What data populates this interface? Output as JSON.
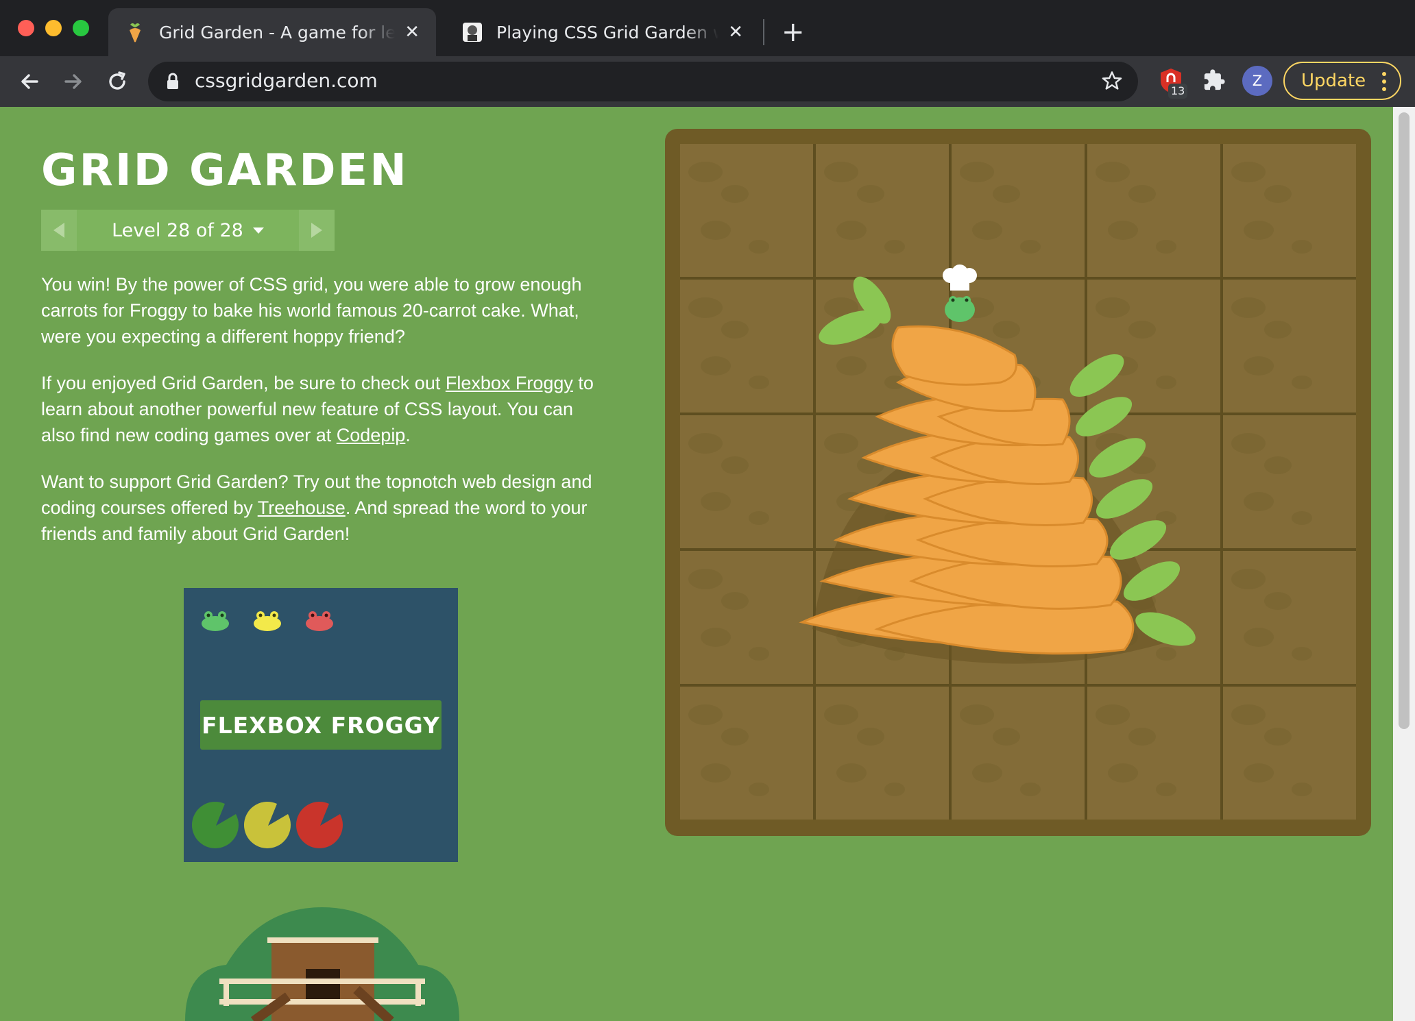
{
  "browser": {
    "tabs": [
      {
        "title": "Grid Garden - A game for learning CSS grid",
        "active": true
      },
      {
        "title": "Playing CSS Grid Garden with Aaron",
        "active": false
      }
    ],
    "url": "cssgridgarden.com",
    "extension_badge": "13",
    "profile_initial": "Z",
    "update_label": "Update"
  },
  "page": {
    "title": "GRID GARDEN",
    "level_label": "Level 28 of 28",
    "paragraphs": {
      "p1": "You win! By the power of CSS grid, you were able to grow enough carrots for Froggy to bake his world famous 20-carrot cake. What, were you expecting a different hoppy friend?",
      "p2_before": "If you enjoyed Grid Garden, be sure to check out ",
      "p2_link1": "Flexbox Froggy",
      "p2_mid": " to learn about another powerful new feature of CSS layout. You can also find new coding games over at ",
      "p2_link2": "Codepip",
      "p2_end": ".",
      "p3_before": "Want to support Grid Garden? Try out the topnotch web design and coding courses offered by ",
      "p3_link": "Treehouse",
      "p3_after": ". And spread the word to your friends and family about Grid Garden!"
    },
    "ad": {
      "label": "FLEXBOX FROGGY"
    },
    "board": {
      "rows": 5,
      "columns": 5
    }
  },
  "colors": {
    "page_bg": "#6fa451",
    "board_frame": "#6f5b26",
    "soil": "#836c38",
    "carrot": "#f0a546",
    "leaf": "#8bc653",
    "ad_bg": "#2d5268",
    "update_accent": "#fdd663"
  },
  "icons": [
    "back-arrow-icon",
    "forward-arrow-icon",
    "reload-icon",
    "lock-icon",
    "star-icon",
    "shield-extension-icon",
    "puzzle-icon",
    "kebab-menu-icon",
    "carrot-favicon",
    "close-icon",
    "plus-icon",
    "triangle-left-icon",
    "triangle-right-icon",
    "caret-down-icon"
  ]
}
